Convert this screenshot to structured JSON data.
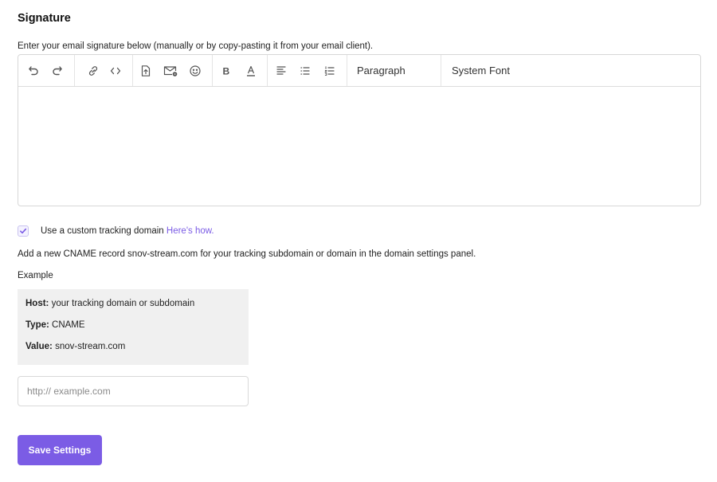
{
  "signature": {
    "title": "Signature",
    "description": "Enter your email signature below (manually or by copy-pasting it from your email client).",
    "toolbar": {
      "icons": [
        "undo-icon",
        "redo-icon",
        "link-icon",
        "code-icon",
        "file-upload-icon",
        "email-template-icon",
        "emoji-icon",
        "bold-icon",
        "text-color-icon",
        "align-left-icon",
        "bullet-list-icon",
        "numbered-list-icon"
      ],
      "paragraph_label": "Paragraph",
      "font_label": "System Font"
    },
    "body_text": ""
  },
  "tracking": {
    "checked": true,
    "label": "Use a custom tracking domain",
    "link_text": "Here's how.",
    "cname_text": "Add a new CNAME record snov-stream.com for your tracking subdomain or domain in the domain settings panel.",
    "example_label": "Example",
    "example": {
      "host_key": "Host:",
      "host_value": "your tracking domain or subdomain",
      "type_key": "Type:",
      "type_value": "CNAME",
      "value_key": "Value:",
      "value_value": "snov-stream.com"
    },
    "input_placeholder": "http:// example.com",
    "input_value": ""
  },
  "save_label": "Save Settings",
  "colors": {
    "accent": "#7b5ce5",
    "example_bg": "#f0f0f0",
    "border": "#d7d7d7"
  }
}
